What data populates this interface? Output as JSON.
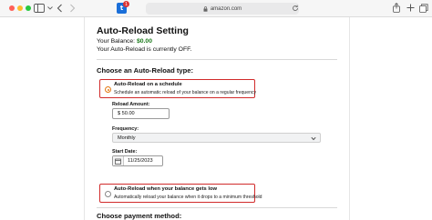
{
  "browser": {
    "url": "amazon.com",
    "extension_count": "1"
  },
  "page": {
    "title": "Auto-Reload Setting",
    "balance_label": "Your Balance:",
    "balance_value": "$0.00",
    "status_text": "Your Auto-Reload is currently OFF.",
    "choose_type_heading": "Choose an Auto-Reload type:",
    "schedule_option": {
      "title": "Auto-Reload on a schedule",
      "description": "Schedule an automatic reload of your balance on a regular frequency",
      "selected": true
    },
    "reload_amount": {
      "label": "Reload Amount:",
      "value": "$ 50.00"
    },
    "frequency": {
      "label": "Frequency:",
      "value": "Monthly"
    },
    "start_date": {
      "label": "Start Date:",
      "value": "11/25/2023"
    },
    "low_balance_option": {
      "title": "Auto-Reload when your balance gets low",
      "description": "Automatically reload your balance when it drops to a minimum threshold",
      "selected": false
    },
    "payment_heading": "Choose payment method:"
  },
  "colors": {
    "highlight_border": "#d12b2b",
    "balance_green": "#1a7a1a",
    "radio_orange": "#e47911"
  }
}
